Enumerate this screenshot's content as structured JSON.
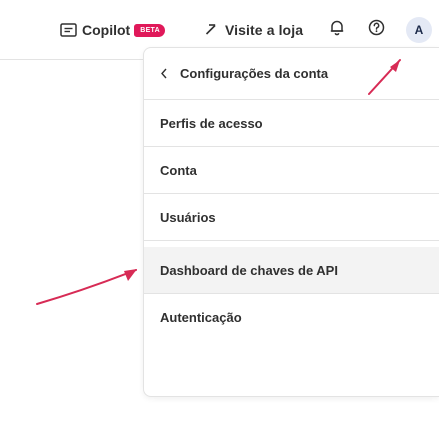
{
  "topbar": {
    "copilot_label": "Copilot",
    "beta_badge": "BETA",
    "visit_store_label": "Visite a loja",
    "notifications_icon": "bell-icon",
    "help_icon": "help-icon",
    "avatar_initial": "A"
  },
  "menu": {
    "header_title": "Configurações da conta",
    "items": [
      {
        "label": "Perfis de acesso"
      },
      {
        "label": "Conta"
      },
      {
        "label": "Usuários"
      },
      {
        "label": "Dashboard de chaves de API",
        "active": true
      },
      {
        "label": "Autenticação"
      }
    ]
  },
  "colors": {
    "beta_badge": "#e0195a",
    "annotation_arrow": "#d72b55",
    "active_item_bg": "#f3f3f3",
    "avatar_bg": "#e4e9f5"
  }
}
